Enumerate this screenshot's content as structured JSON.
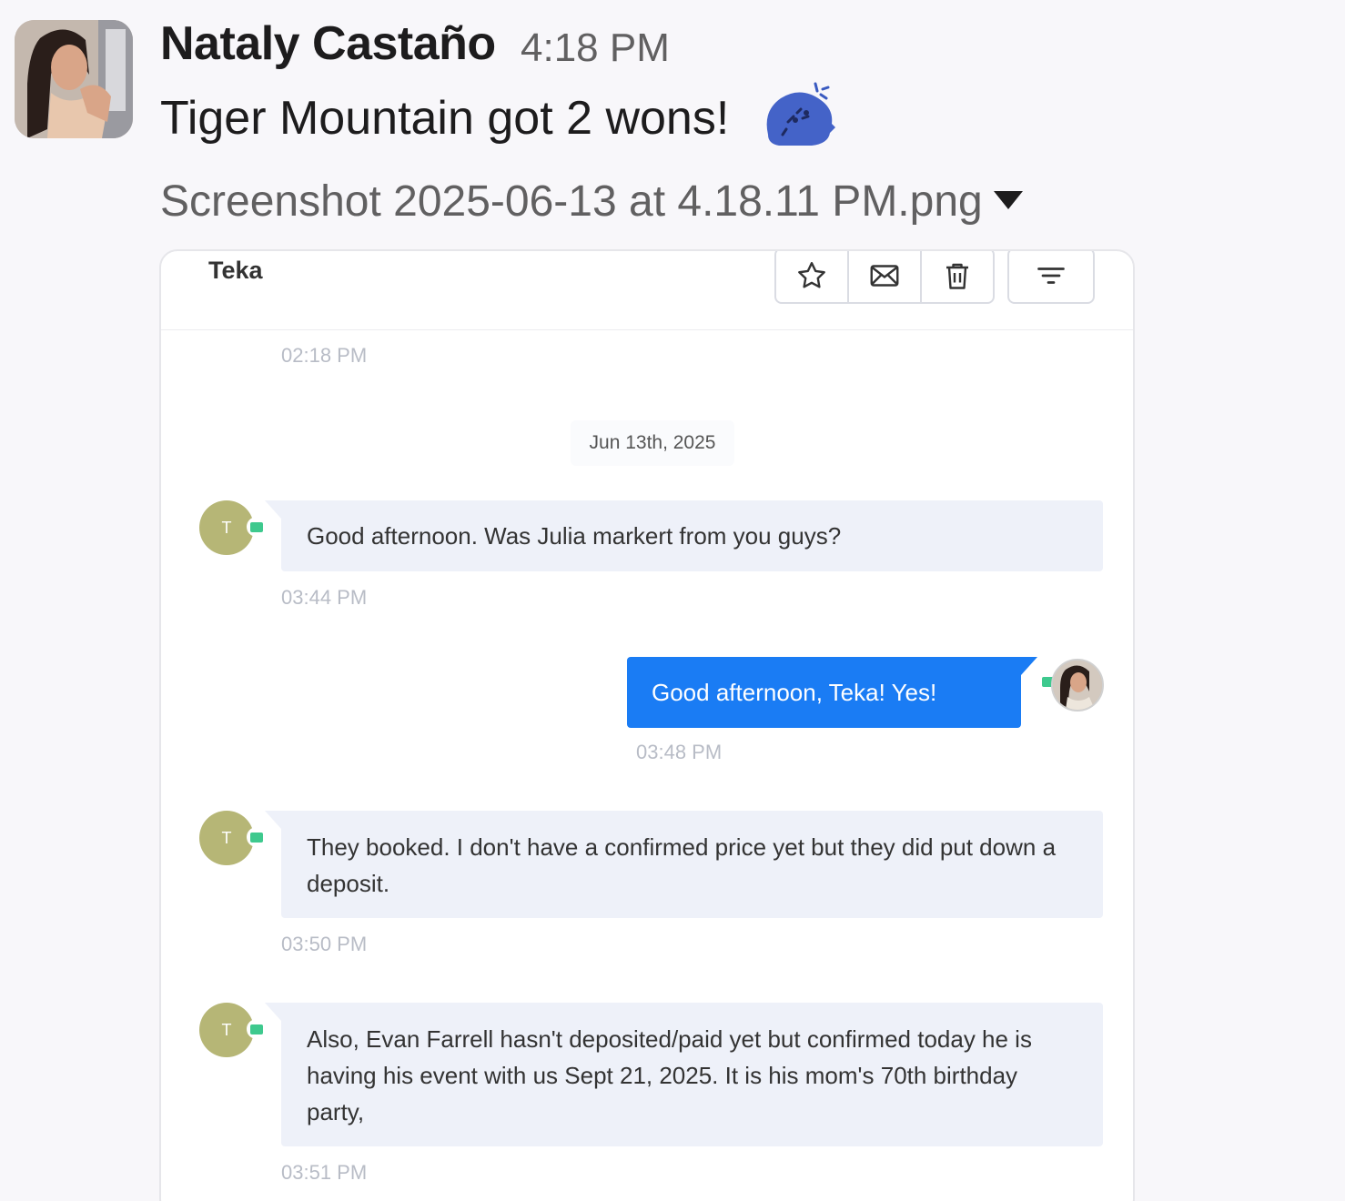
{
  "message": {
    "sender": "Nataly Castaño",
    "time": "4:18 PM",
    "text": "Tiger Mountain got 2 wons!",
    "emoji": "blue-blob-party-emoji"
  },
  "file": {
    "name": "Screenshot 2025-06-13 at 4.18.11 PM.png",
    "caret_icon": "caret-down-icon"
  },
  "conversation": {
    "contact_name": "Teka",
    "toolbar": [
      "star-icon",
      "mail-icon",
      "trash-icon",
      "filter-icon"
    ],
    "first_time": "02:18 PM",
    "date_separator": "Jun 13th, 2025",
    "contact_initial": "T",
    "messages": [
      {
        "direction": "in",
        "text": "Good afternoon.  Was Julia markert from you guys?",
        "time": "03:44 PM"
      },
      {
        "direction": "out",
        "text": "Good afternoon, Teka! Yes!",
        "time": "03:48 PM"
      },
      {
        "direction": "in",
        "text": "They booked.  I don't have a confirmed price yet but they did put down a deposit.",
        "time": "03:50 PM"
      },
      {
        "direction": "in",
        "text": "Also, Evan Farrell hasn't deposited/paid yet but confirmed today he is having his event with us Sept 21, 2025. It is his mom's 70th birthday party,",
        "time": "03:51 PM"
      }
    ],
    "colors": {
      "incoming_bubble": "#eef1f9",
      "outgoing_bubble": "#1a7cf4",
      "contact_avatar": "#b6b676",
      "channel_badge": "#3ec98e"
    }
  }
}
